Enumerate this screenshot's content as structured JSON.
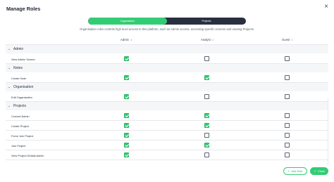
{
  "dialog": {
    "title": "Manage Roles",
    "close_icon": "×"
  },
  "toggle": {
    "options": [
      "Organisation",
      "Projects"
    ],
    "active": "Organisation"
  },
  "description": "Organisation roles controls high level access to this platform, such as Admin access, accessing specific screens and viewing Projects.",
  "columns": [
    "Admin",
    "Analyst",
    "Guest"
  ],
  "sort_icon": "⇕",
  "chevron_icon": "⌄",
  "sections": [
    {
      "name": "Admin",
      "rows": [
        {
          "label": "View Admin Screen",
          "values": [
            true,
            false,
            false
          ]
        }
      ]
    },
    {
      "name": "Notes",
      "rows": [
        {
          "label": "Create Note",
          "values": [
            true,
            true,
            false
          ]
        }
      ]
    },
    {
      "name": "Organisation",
      "rows": [
        {
          "label": "Edit Organisation",
          "values": [
            true,
            false,
            false
          ]
        }
      ]
    },
    {
      "name": "Projects",
      "rows": [
        {
          "label": "Convert Admin",
          "values": [
            true,
            true,
            false
          ]
        },
        {
          "label": "Create Project",
          "values": [
            true,
            true,
            false
          ]
        },
        {
          "label": "Force Join Project",
          "values": [
            true,
            false,
            false
          ]
        },
        {
          "label": "Join Project",
          "values": [
            true,
            true,
            false
          ]
        },
        {
          "label": "View Project Details Admin",
          "values": [
            true,
            false,
            false
          ]
        }
      ]
    }
  ],
  "buttons": {
    "add": {
      "label": "Add Role",
      "icon": "+"
    },
    "close": {
      "label": "Close",
      "icon": "✓"
    }
  },
  "colors": {
    "accent": "#33cc75",
    "toggle_bg": "#283040"
  }
}
